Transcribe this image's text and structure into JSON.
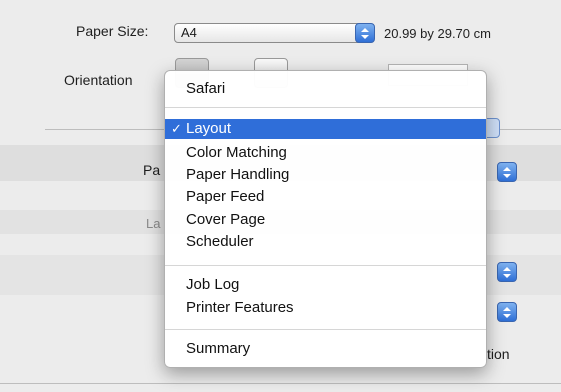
{
  "dialog": {
    "paper_size_label": "Paper Size:",
    "paper_size_value": "A4",
    "paper_size_dims": "20.99 by 29.70 cm",
    "orientation_label": "Orientation",
    "partial_label_1": "Pa",
    "partial_label_2": "La",
    "partial_label_3": "tion"
  },
  "menu": {
    "items": [
      {
        "label": "Safari",
        "selected": false
      },
      {
        "label": "Layout",
        "selected": true
      },
      {
        "label": "Color Matching",
        "selected": false
      },
      {
        "label": "Paper Handling",
        "selected": false
      },
      {
        "label": "Paper Feed",
        "selected": false
      },
      {
        "label": "Cover Page",
        "selected": false
      },
      {
        "label": "Scheduler",
        "selected": false
      },
      {
        "label": "Job Log",
        "selected": false
      },
      {
        "label": "Printer Features",
        "selected": false
      },
      {
        "label": "Summary",
        "selected": false
      }
    ],
    "check_glyph": "✓"
  },
  "colors": {
    "selection": "#2f6ed9",
    "stepper": "#3b7be0"
  },
  "icons": {
    "stepper": "up-down-arrows-icon",
    "portrait": "portrait-orientation-icon",
    "landscape": "landscape-orientation-icon"
  }
}
